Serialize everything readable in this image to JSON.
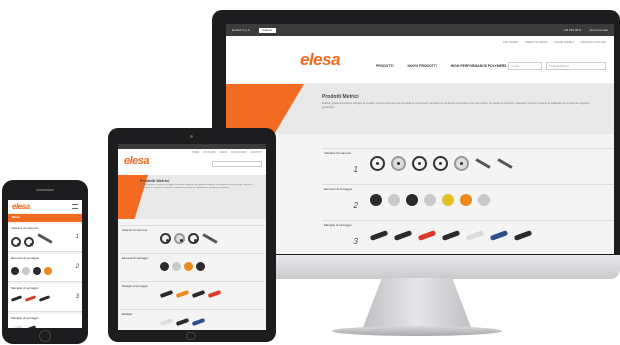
{
  "brand": {
    "logo": "elesa",
    "accent": "#f36b21"
  },
  "desktop": {
    "topbar": {
      "left": "ELESA S.p.A.",
      "lang": "Italiano",
      "phone": "+39 039 2811",
      "right": "Area riservata"
    },
    "links": [
      "CHI SIAMO",
      "MEDIA E NEWS",
      "DOVE SIAMO",
      "LAVORA CON NOI"
    ],
    "nav": [
      "PRODOTTI",
      "NUOVI PRODOTTI",
      "HIGH-PERFORMANCE POLYMERS"
    ],
    "search_placeholder": "Cerca",
    "search2_placeholder": "Prodotti Metrici",
    "hero": {
      "title": "Prodotti Metrici",
      "text": "ELESA, grazie al continuo sviluppo di prodotti, propone una gamma completa di componenti standard per l'industria meccanica e per gli impianti. La varietà di soluzioni, materiali e finiture consente di soddisfare le più diverse esigenze applicative."
    },
    "categories": [
      {
        "name": "Volantini di manovra",
        "num": "1"
      },
      {
        "name": "Elementi di serraggio",
        "num": "2"
      },
      {
        "name": "Maniglie di serraggio",
        "num": "3"
      }
    ]
  },
  "tablet": {
    "links": [
      "HOME",
      "CHI SIAMO",
      "MEDIA",
      "DOVE SIAMO",
      "CONTATTI"
    ],
    "hero": {
      "title": "Prodotti Metrici",
      "text": "ELESA, grazie al continuo sviluppo di prodotti, propone una gamma completa di componenti standard per l'industria meccanica. La varietà di soluzioni e materiali consente di soddisfare le più diverse esigenze."
    },
    "categories": [
      {
        "name": "Volantini di manovra"
      },
      {
        "name": "Elementi di serraggio"
      },
      {
        "name": "Maniglie di serraggio"
      },
      {
        "name": "Maniglie"
      }
    ]
  },
  "phone": {
    "bar_label": "Menu",
    "categories": [
      {
        "name": "Volantini di manovra",
        "num": "1"
      },
      {
        "name": "Elementi di serraggio",
        "num": "2"
      },
      {
        "name": "Maniglie di serraggio",
        "num": "3"
      },
      {
        "name": "Maniglie di serraggio",
        "num": ""
      }
    ]
  }
}
